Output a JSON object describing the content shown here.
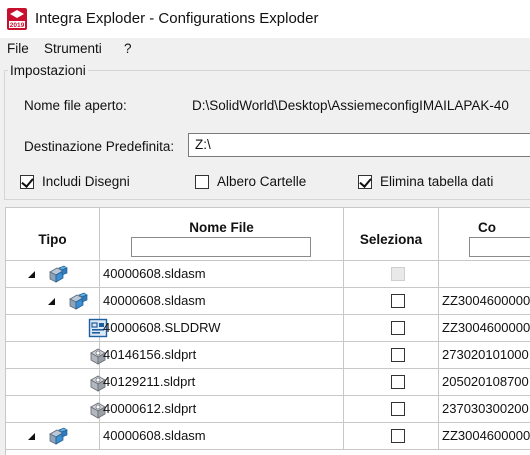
{
  "window": {
    "title": "Integra Exploder - Configurations Exploder"
  },
  "app_icon": {
    "name": "integra-exploder-logo",
    "year": "2019",
    "brand_color": "#c8102e"
  },
  "menu": [
    {
      "label": "File"
    },
    {
      "label": "Strumenti"
    },
    {
      "label": "?"
    }
  ],
  "settings": {
    "legend": "Impostazioni",
    "open_file_label": "Nome file aperto:",
    "open_file_value": "D:\\SolidWorld\\Desktop\\AssiemeconfigIMAILAPAK-40",
    "default_dest_label": "Destinazione Predefinita:",
    "default_dest_value": "Z:\\",
    "options": [
      {
        "label": "Includi Disegni",
        "checked": true
      },
      {
        "label": "Albero Cartelle",
        "checked": false
      },
      {
        "label": "Elimina tabella dati",
        "checked": true
      }
    ]
  },
  "grid": {
    "columns": [
      {
        "label": "Tipo"
      },
      {
        "label": "Nome File"
      },
      {
        "label": "Seleziona"
      },
      {
        "label": "Co"
      }
    ],
    "rows": [
      {
        "icon": "assembly-icon",
        "expandable": true,
        "file": "40000608.sldasm",
        "selectable": false,
        "checked": false,
        "code": ""
      },
      {
        "icon": "assembly-icon",
        "expandable": true,
        "file": "40000608.sldasm",
        "selectable": true,
        "checked": false,
        "code": "ZZ3004600000"
      },
      {
        "icon": "drawing-icon",
        "expandable": false,
        "file": "40000608.SLDDRW",
        "selectable": true,
        "checked": false,
        "code": "ZZ3004600000"
      },
      {
        "icon": "part-icon",
        "expandable": false,
        "file": "40146156.sldprt",
        "selectable": true,
        "checked": false,
        "code": "273020101000"
      },
      {
        "icon": "part-icon",
        "expandable": false,
        "file": "40129211.sldprt",
        "selectable": true,
        "checked": false,
        "code": "205020108700"
      },
      {
        "icon": "part-icon",
        "expandable": false,
        "file": "40000612.sldprt",
        "selectable": true,
        "checked": false,
        "code": "237030300200"
      },
      {
        "icon": "assembly-icon",
        "expandable": true,
        "file": "40000608.sldasm",
        "selectable": true,
        "checked": false,
        "code": "ZZ3004600000"
      }
    ]
  }
}
